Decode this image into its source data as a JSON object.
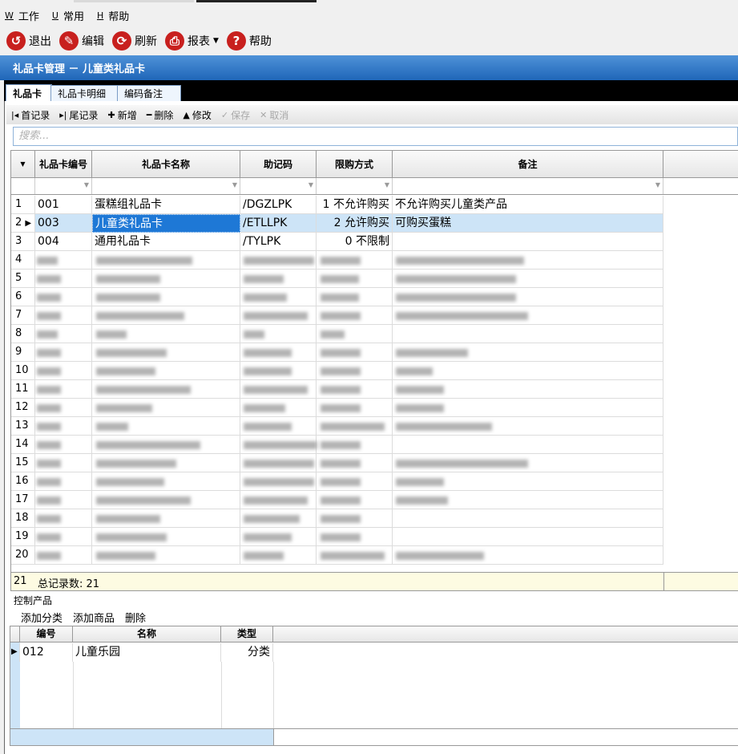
{
  "menu": [
    {
      "acc": "W",
      "label": "工作"
    },
    {
      "acc": "U",
      "label": "常用"
    },
    {
      "acc": "H",
      "label": "帮助"
    }
  ],
  "toolbar": {
    "exit": "退出",
    "edit": "编辑",
    "refresh": "刷新",
    "report": "报表",
    "help": "帮助"
  },
  "window_title": "礼品卡管理 － 儿童类礼品卡",
  "tabs": [
    "礼品卡",
    "礼品卡明细",
    "编码备注"
  ],
  "navbar": {
    "first": "首记录",
    "last": "尾记录",
    "add": "新增",
    "delete": "删除",
    "modify": "修改",
    "save": "保存",
    "cancel": "取消"
  },
  "search_placeholder": "搜索...",
  "grid": {
    "columns": [
      "礼品卡编号",
      "礼品卡名称",
      "助记码",
      "限购方式",
      "备注"
    ],
    "rows": [
      {
        "n": "1",
        "code": "001",
        "name": "蛋糕组礼品卡",
        "mnem": "/DGZLPK",
        "limit": "1 不允许购买",
        "note": "不允许购买儿童类产品"
      },
      {
        "n": "2",
        "code": "003",
        "name": "儿童类礼品卡",
        "mnem": "/ETLLPK",
        "limit": "2 允许购买",
        "note": "可购买蛋糕"
      },
      {
        "n": "3",
        "code": "004",
        "name": "通用礼品卡",
        "mnem": "/TYLPK",
        "limit": "0 不限制",
        "note": ""
      }
    ],
    "blurred_row_numbers": [
      "4",
      "5",
      "6",
      "7",
      "8",
      "9",
      "10",
      "11",
      "12",
      "13",
      "14",
      "15",
      "16",
      "17",
      "18",
      "19",
      "20"
    ],
    "footer_count_num": "21",
    "footer_text": "总记录数: 21"
  },
  "section_label": "控制产品",
  "sub_toolbar": {
    "add_category": "添加分类",
    "add_product": "添加商品",
    "delete": "删除"
  },
  "subgrid": {
    "columns": [
      "编号",
      "名称",
      "类型"
    ],
    "rows": [
      {
        "code": "012",
        "name": "儿童乐园",
        "type": "分类"
      }
    ]
  },
  "colors": {
    "title_bar": "#2a71c0",
    "selection": "#cde4f7",
    "focus": "#1e78d6",
    "icon_red": "#c8201e"
  }
}
